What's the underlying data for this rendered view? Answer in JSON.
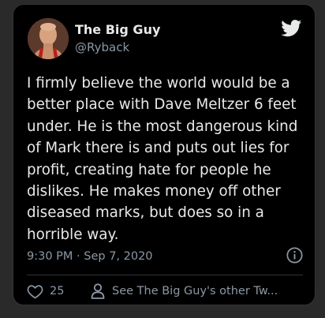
{
  "tweet": {
    "author": {
      "display_name": "The Big Guy",
      "handle": "@Ryback",
      "avatar_icon": "avatar-photo"
    },
    "text": "I firmly believe the world would be a\nbetter place with Dave Meltzer 6 feet\nunder. He is the most dangerous kind\nof Mark there is and puts out lies for\nprofit, creating hate for people he\ndislikes. He makes money off other\ndiseased marks, but does so in a\nhorrible way.",
    "timestamp": "9:30 PM · Sep 7, 2020",
    "likes": "25",
    "profile_link": "See The Big Guy's other Tw..."
  },
  "icons": {
    "brand": "twitter-bird-icon",
    "info": "info-icon",
    "like": "heart-icon",
    "user": "user-icon"
  },
  "colors": {
    "card_background": "#000000",
    "page_background": "#2a2a2a",
    "primary_text": "#e7e9ea",
    "secondary_text": "#8b98a5",
    "border": "#2f3336"
  }
}
